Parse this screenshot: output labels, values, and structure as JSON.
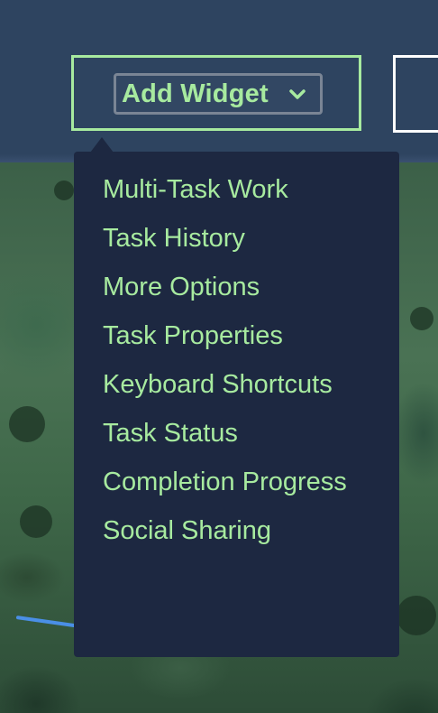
{
  "toolbar": {
    "add_widget_label": "Add Widget",
    "add_widget_icon": "chevron-down-icon"
  },
  "menu": {
    "items": [
      {
        "label": "Multi-Task Work"
      },
      {
        "label": "Task History"
      },
      {
        "label": "More Options"
      },
      {
        "label": "Task Properties"
      },
      {
        "label": "Keyboard Shortcuts"
      },
      {
        "label": "Task Status"
      },
      {
        "label": "Completion Progress"
      },
      {
        "label": "Social Sharing"
      }
    ]
  },
  "colors": {
    "toolbar_bg": "#2e4460",
    "accent_green": "#a7ea9f",
    "menu_bg": "#1d2841",
    "route_blue": "#4a8fe6"
  }
}
